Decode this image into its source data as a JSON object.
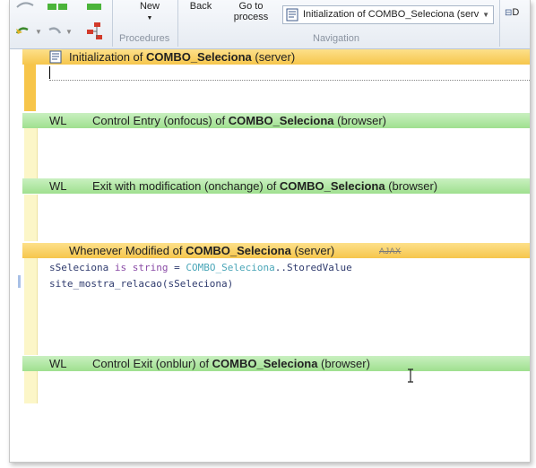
{
  "ribbon": {
    "new_label": "New",
    "back_label": "Back",
    "goto_label_line1": "Go to",
    "goto_label_line2": "process",
    "group_procedures": "Procedures",
    "group_navigation": "Navigation",
    "combo_value": "Initialization of COMBO_Seleciona (serv",
    "right_button_label": "D"
  },
  "editor": {
    "control_name": "COMBO_Seleciona",
    "sections": [
      {
        "prefix": "",
        "before": "Initialization of ",
        "after": " (server)"
      },
      {
        "prefix": "WL",
        "before": "Control Entry (onfocus) of ",
        "after": " (browser)"
      },
      {
        "prefix": "WL",
        "before": "Exit with modification (onchange) of ",
        "after": " (browser)"
      },
      {
        "prefix": "",
        "before": "Whenever Modified of ",
        "after": " (server)",
        "badge": "AJAX"
      },
      {
        "prefix": "WL",
        "before": "Control Exit (onblur) of ",
        "after": " (browser)"
      }
    ],
    "code": {
      "line1_var": "sSeleciona",
      "line1_is": " is ",
      "line1_type": "string",
      "line1_eq": " = ",
      "line1_ctl": "COMBO_Seleciona",
      "line1_rest": "..StoredValue",
      "line2": "site_mostra_relacao(sSeleciona)"
    }
  },
  "colors": {
    "server_header": "#f6c64c",
    "browser_header": "#9fe08f",
    "gutter": "#fcf6c8"
  }
}
